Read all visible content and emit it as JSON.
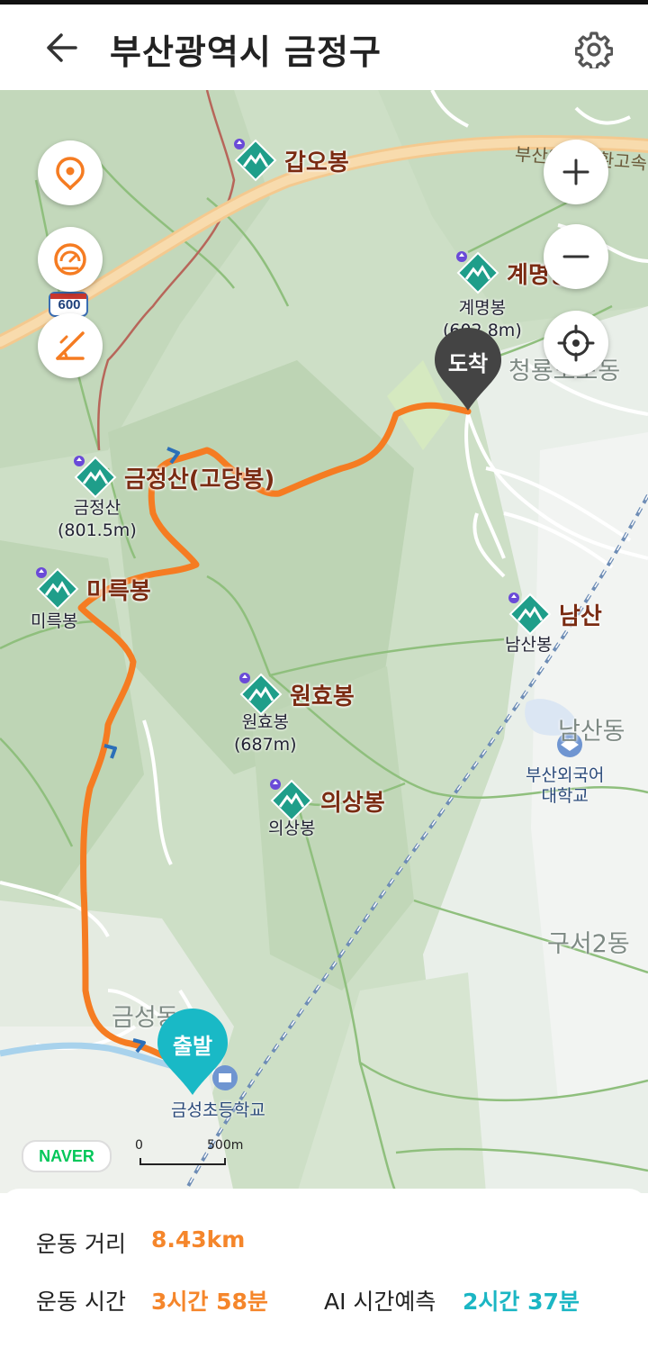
{
  "header": {
    "title": "부산광역시 금정구",
    "back_icon": "arrow-left-icon",
    "settings_icon": "gear-icon"
  },
  "map": {
    "controls_left": [
      {
        "icon": "location-pin-icon"
      },
      {
        "icon": "speedometer-icon"
      },
      {
        "icon": "slope-icon"
      }
    ],
    "controls_right": [
      {
        "icon": "zoom-in-icon"
      },
      {
        "icon": "zoom-out-icon"
      },
      {
        "icon": "crosshair-icon"
      }
    ],
    "peaks": [
      {
        "name": "갑오봉"
      },
      {
        "name": "계명봉",
        "sub1": "계명봉",
        "sub2": "(602.8m)"
      },
      {
        "name": "금정산(고당봉)",
        "sub1": "금정산",
        "sub2": "(801.5m)"
      },
      {
        "name": "미륵봉",
        "sub1": "미륵봉"
      },
      {
        "name": "남산",
        "sub1": "남산봉"
      },
      {
        "name": "원효봉",
        "sub1": "원효봉",
        "sub2": "(687m)"
      },
      {
        "name": "의상봉",
        "sub1": "의상봉"
      }
    ],
    "areas": {
      "cheongnyong": "청룡노포동",
      "namsan": "남산동",
      "guseo": "구서2동",
      "geumseong": "금성동"
    },
    "pois": {
      "university_line1": "부산외국어",
      "university_line2": "대학교",
      "school": "금성초등학교"
    },
    "road": {
      "highway_text": "부산외곽순환고속",
      "route_number": "600"
    },
    "arrive_label": "도착",
    "start_label": "출발",
    "logo": "NAVER",
    "scale_zero": "0",
    "scale_distance": "500m",
    "colors": {
      "route": "#f57c22",
      "peak_icon": "#1f9e8a",
      "arrive_pin": "#444444",
      "start_pin": "#19b9c6"
    }
  },
  "stats": {
    "distance_label": "운동 거리",
    "distance_value": "8.43km",
    "time_label": "운동 시간",
    "time_value": "3시간 58분",
    "ai_label": "AI 시간예측",
    "ai_value": "2시간 37분"
  }
}
